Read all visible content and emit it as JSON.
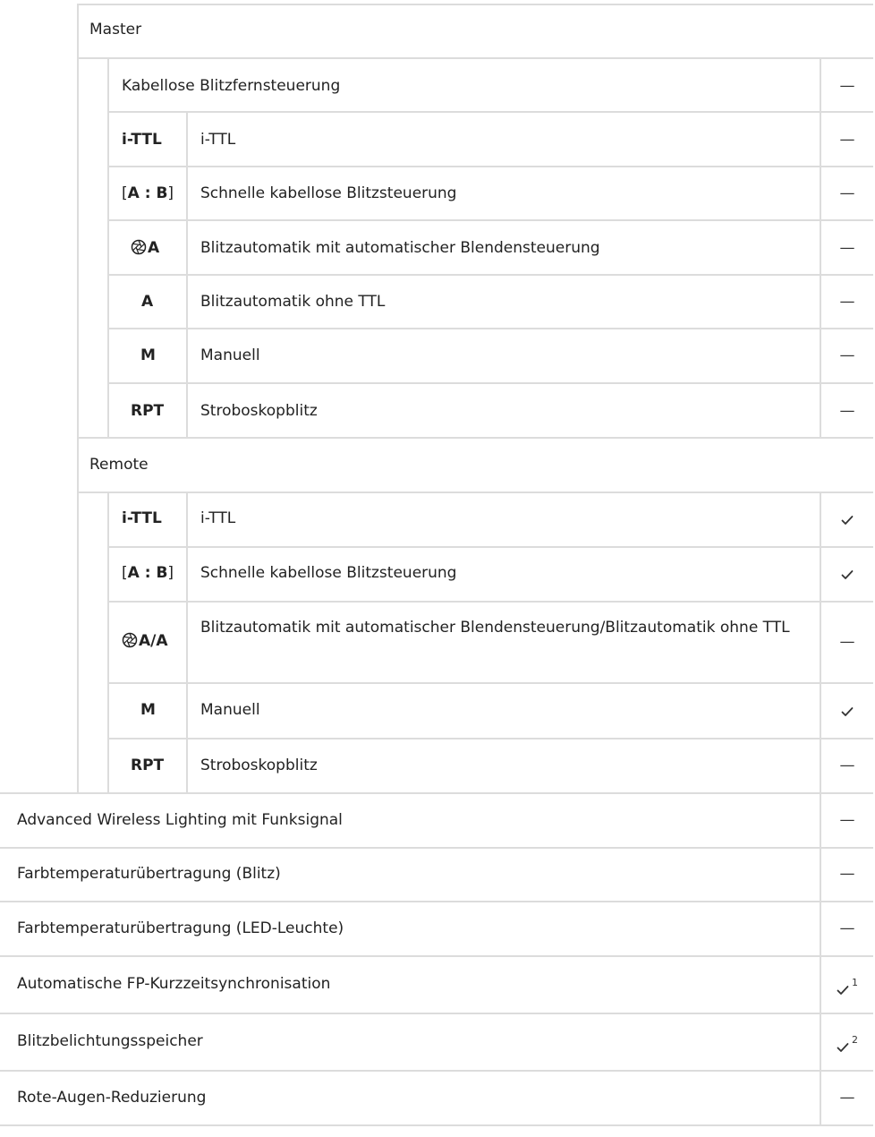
{
  "sections": {
    "master": "Master",
    "remote": "Remote"
  },
  "master": {
    "wireless_control": {
      "label": "Kabellose Blitzfernsteuerung",
      "mark": "—"
    },
    "modes": [
      {
        "code": "i-TTL",
        "label": "i-TTL",
        "mark": "—"
      },
      {
        "code_open": "[",
        "code_a": "A",
        "code_sep": " : ",
        "code_b": "B",
        "code_close": "]",
        "label": "Schnelle kabellose Blitzsteuerung",
        "mark": "—"
      },
      {
        "icon": "aperture-icon",
        "code": "A",
        "label": "Blitzautomatik mit automatischer Blendensteuerung",
        "mark": "—"
      },
      {
        "code": "A",
        "label": "Blitzautomatik ohne TTL",
        "mark": "—"
      },
      {
        "code": "M",
        "label": "Manuell",
        "mark": "—"
      },
      {
        "code": "RPT",
        "label": "Stroboskopblitz",
        "mark": "—"
      }
    ]
  },
  "remote": {
    "modes": [
      {
        "code": "i-TTL",
        "label": "i-TTL",
        "mark": "check"
      },
      {
        "code_open": "[",
        "code_a": "A",
        "code_sep": " : ",
        "code_b": "B",
        "code_close": "]",
        "label": "Schnelle kabellose Blitzsteuerung",
        "mark": "check"
      },
      {
        "icon": "aperture-icon",
        "code": "A/A",
        "label": "Blitzautomatik mit automatischer Blendensteuerung/Blitzautomatik ohne TTL",
        "mark": "—"
      },
      {
        "code": "M",
        "label": "Manuell",
        "mark": "check"
      },
      {
        "code": "RPT",
        "label": "Stroboskopblitz",
        "mark": "—"
      }
    ]
  },
  "features": [
    {
      "label": "Advanced Wireless Lighting mit Funksignal",
      "mark": "—"
    },
    {
      "label": "Farbtemperaturübertragung (Blitz)",
      "mark": "—"
    },
    {
      "label": "Farbtemperaturübertragung (LED-Leuchte)",
      "mark": "—"
    },
    {
      "label": "Automatische FP-Kurzzeitsynchronisation",
      "mark": "check",
      "footnote": "1"
    },
    {
      "label": "Blitzbelichtungsspeicher",
      "mark": "check",
      "footnote": "2"
    },
    {
      "label": "Rote-Augen-Reduzierung",
      "mark": "—"
    }
  ],
  "colors": {
    "grid": "#dcdcdc",
    "text": "#222222"
  }
}
